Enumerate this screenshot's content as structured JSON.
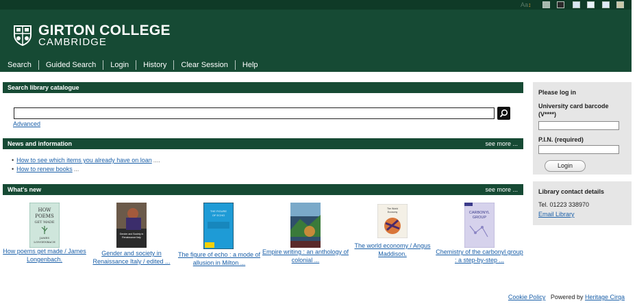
{
  "topbar": {
    "text_size_label": "Aa",
    "text_size_arrow": "↕",
    "swatches": [
      "#a6b8ad",
      "#2a2a2a",
      "#d9e6f2",
      "#e8f1f8",
      "#dfe9f6",
      "#c9c7a8"
    ]
  },
  "header": {
    "college_name": "GIRTON COLLEGE",
    "college_sub": "CAMBRIDGE"
  },
  "nav": {
    "items": [
      "Search",
      "Guided Search",
      "Login",
      "History",
      "Clear Session",
      "Help"
    ]
  },
  "search": {
    "title": "Search library catalogue",
    "input_value": "",
    "advanced_label": "Advanced"
  },
  "news": {
    "title": "News and information",
    "see_more": "see more ...",
    "items": [
      {
        "label": "How to see which items you already have on loan",
        "ellipsis": "...."
      },
      {
        "label": "How to renew books",
        "ellipsis": "..."
      }
    ]
  },
  "whats_new": {
    "title": "What's new",
    "see_more": "see more ...",
    "books": [
      {
        "title": "How poems get made / James Longenbach.",
        "cover_text": [
          "HOW",
          "POEMS",
          "GET MADE",
          "JAMES",
          "LONGENBACH"
        ]
      },
      {
        "title": "Gender and society in Renaissance Italy / edited ...",
        "cover_text": [
          "Gender and Society in",
          "Renaissance Italy"
        ]
      },
      {
        "title": "The figure of echo : a mode of allusion in Milton ...",
        "cover_text": [
          "THE FIGURE",
          "OF ECHO"
        ]
      },
      {
        "title": "Empire writing : an anthology of colonial ...",
        "cover_text": []
      },
      {
        "title": "The world economy / Angus Maddison.",
        "cover_text": [
          "The World",
          "Economy"
        ]
      },
      {
        "title": "Chemistry of the carbonyl group : a step-by-step ...",
        "cover_text": [
          "CARBONYL",
          "GROUP"
        ]
      }
    ]
  },
  "login_panel": {
    "title": "Please log in",
    "barcode_label": "University card barcode (V****)",
    "barcode_value": "",
    "pin_label": "P.I.N. (required)",
    "pin_value": "",
    "login_button": "Login"
  },
  "contact_panel": {
    "title": "Library contact details",
    "tel": "Tel.  01223 338970",
    "email_label": "Email Library"
  },
  "footer": {
    "cookie_label": "Cookie Policy",
    "powered_prefix": "Powered by",
    "powered_link": "Heritage Cirqa"
  }
}
